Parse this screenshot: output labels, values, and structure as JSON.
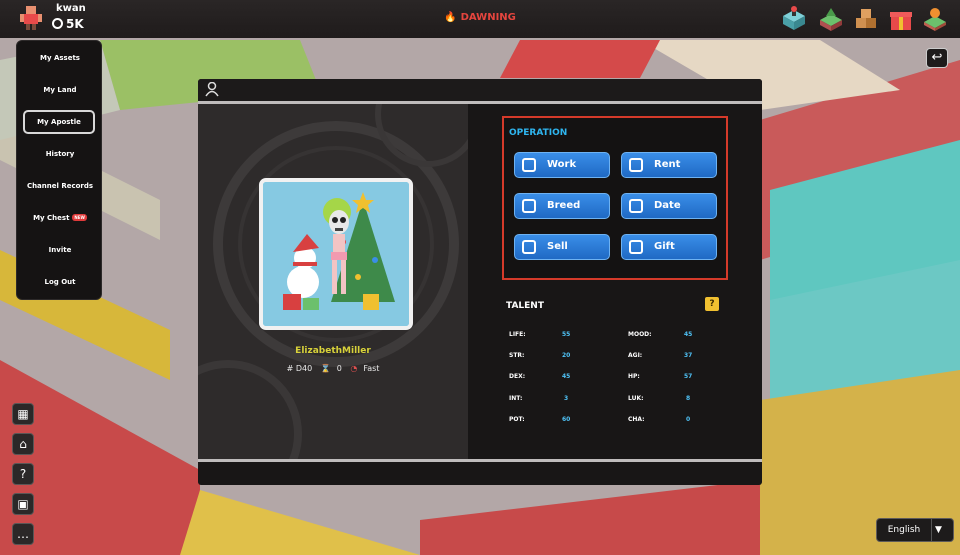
{
  "player": {
    "name": "kwan",
    "balance": "5K"
  },
  "status": {
    "label": "DAWNING"
  },
  "menu": {
    "items": [
      {
        "label": "My Assets"
      },
      {
        "label": "My Land"
      },
      {
        "label": "My Apostle"
      },
      {
        "label": "History"
      },
      {
        "label": "Channel Records"
      },
      {
        "label": "My Chest",
        "badge": "NEW"
      },
      {
        "label": "Invite"
      },
      {
        "label": "Log Out"
      }
    ],
    "active_index": 2
  },
  "character": {
    "name": "ElizabethMiller",
    "id": "# D40",
    "count": "0",
    "speed": "Fast"
  },
  "operation": {
    "title": "OPERATION",
    "buttons": [
      "Work",
      "Rent",
      "Breed",
      "Date",
      "Sell",
      "Gift"
    ]
  },
  "talent": {
    "title": "TALENT",
    "help": "?",
    "left": [
      {
        "label": "LIFE:",
        "value": "55"
      },
      {
        "label": "STR:",
        "value": "20"
      },
      {
        "label": "DEX:",
        "value": "45"
      },
      {
        "label": "INT:",
        "value": "3"
      },
      {
        "label": "POT:",
        "value": "60"
      }
    ],
    "right": [
      {
        "label": "MOOD:",
        "value": "45"
      },
      {
        "label": "AGI:",
        "value": "37"
      },
      {
        "label": "HP:",
        "value": "57"
      },
      {
        "label": "LUK:",
        "value": "8"
      },
      {
        "label": "CHA:",
        "value": "0"
      }
    ]
  },
  "language": {
    "selected": "English"
  },
  "colors": {
    "accent": "#2fb6f0",
    "button": "#2a7bd8",
    "highlight_border": "#d53a2a",
    "name": "#d8d23a",
    "status": "#e5453e"
  },
  "icons": {
    "tools": [
      "box-icon",
      "hud-icon",
      "help-icon",
      "cube-icon",
      "chat-icon"
    ],
    "topbar": [
      "arcade-icon",
      "land-icon",
      "boxes-icon",
      "gift-icon",
      "land-pin-icon"
    ]
  }
}
